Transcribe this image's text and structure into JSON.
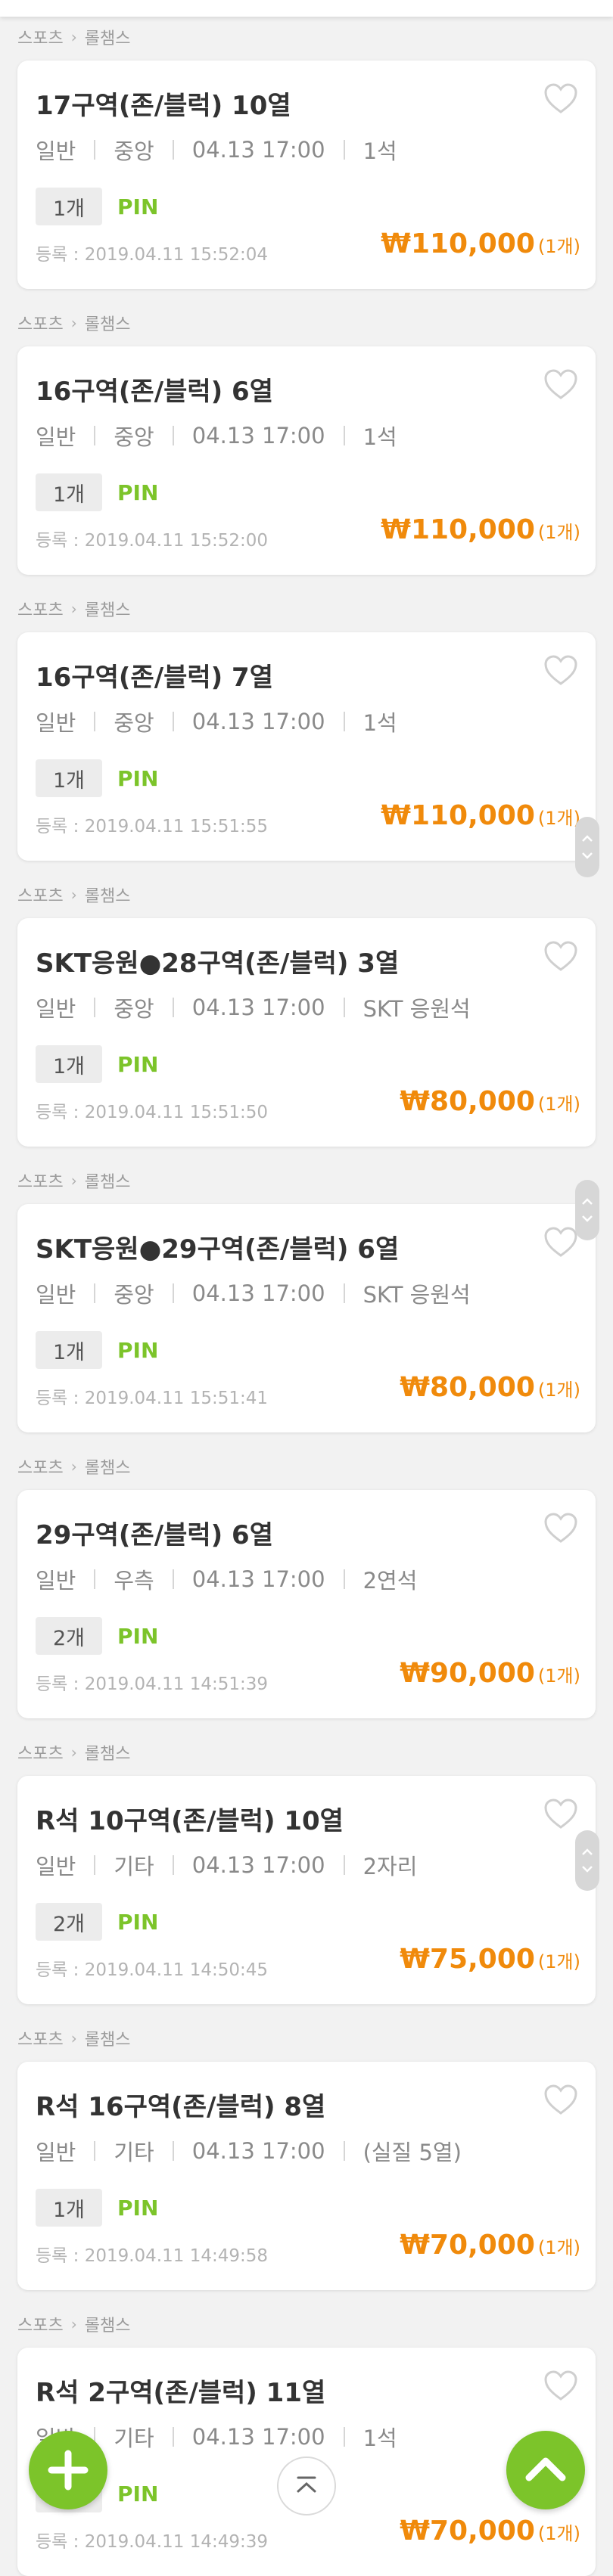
{
  "breadcrumb": {
    "category": "스포츠",
    "subcategory": "롤챔스"
  },
  "listings": [
    {
      "title": "17구역(존/블럭) 10열",
      "type": "일반",
      "position": "중앙",
      "datetime": "04.13 17:00",
      "seat": "1석",
      "quantity": "1개",
      "delivery": "PIN",
      "registered": "등록 : 2019.04.11 15:52:04",
      "price": "₩110,000",
      "price_count": "(1개)"
    },
    {
      "title": "16구역(존/블럭) 6열",
      "type": "일반",
      "position": "중앙",
      "datetime": "04.13 17:00",
      "seat": "1석",
      "quantity": "1개",
      "delivery": "PIN",
      "registered": "등록 : 2019.04.11 15:52:00",
      "price": "₩110,000",
      "price_count": "(1개)"
    },
    {
      "title": "16구역(존/블럭) 7열",
      "type": "일반",
      "position": "중앙",
      "datetime": "04.13 17:00",
      "seat": "1석",
      "quantity": "1개",
      "delivery": "PIN",
      "registered": "등록 : 2019.04.11 15:51:55",
      "price": "₩110,000",
      "price_count": "(1개)"
    },
    {
      "title": "SKT응원●28구역(존/블럭) 3열",
      "type": "일반",
      "position": "중앙",
      "datetime": "04.13 17:00",
      "seat": "SKT 응원석",
      "quantity": "1개",
      "delivery": "PIN",
      "registered": "등록 : 2019.04.11 15:51:50",
      "price": "₩80,000",
      "price_count": "(1개)"
    },
    {
      "title": "SKT응원●29구역(존/블럭) 6열",
      "type": "일반",
      "position": "중앙",
      "datetime": "04.13 17:00",
      "seat": "SKT 응원석",
      "quantity": "1개",
      "delivery": "PIN",
      "registered": "등록 : 2019.04.11 15:51:41",
      "price": "₩80,000",
      "price_count": "(1개)"
    },
    {
      "title": "29구역(존/블럭) 6열",
      "type": "일반",
      "position": "우측",
      "datetime": "04.13 17:00",
      "seat": "2연석",
      "quantity": "2개",
      "delivery": "PIN",
      "registered": "등록 : 2019.04.11 14:51:39",
      "price": "₩90,000",
      "price_count": "(1개)"
    },
    {
      "title": "R석 10구역(존/블럭) 10열",
      "type": "일반",
      "position": "기타",
      "datetime": "04.13 17:00",
      "seat": "2자리",
      "quantity": "2개",
      "delivery": "PIN",
      "registered": "등록 : 2019.04.11 14:50:45",
      "price": "₩75,000",
      "price_count": "(1개)"
    },
    {
      "title": "R석 16구역(존/블럭) 8열",
      "type": "일반",
      "position": "기타",
      "datetime": "04.13 17:00",
      "seat": "(실질 5열)",
      "quantity": "1개",
      "delivery": "PIN",
      "registered": "등록 : 2019.04.11 14:49:58",
      "price": "₩70,000",
      "price_count": "(1개)"
    },
    {
      "title": "R석 2구역(존/블럭) 11열",
      "type": "일반",
      "position": "기타",
      "datetime": "04.13 17:00",
      "seat": "1석",
      "quantity": "1개",
      "delivery": "PIN",
      "registered": "등록 : 2019.04.11 14:49:39",
      "price": "₩70,000",
      "price_count": "(1개)"
    }
  ],
  "colors": {
    "accent": "#7cc42a",
    "price": "#f08a0b",
    "background": "#f2f2f2"
  },
  "icons": {
    "favorite": "heart-outline-icon",
    "add": "plus-icon",
    "scroll_top": "chevron-up-icon",
    "scroll_top_mini": "arrow-to-top-icon",
    "scroll_hint": "chevron-up-down-icon"
  }
}
